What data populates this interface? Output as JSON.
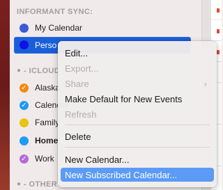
{
  "sidebar": {
    "sections": [
      {
        "header": "INFORMANT SYNC:"
      },
      {
        "header": "- ICLOUD"
      },
      {
        "header": "- OTHER"
      }
    ],
    "calendars": [
      {
        "label": "My Calendar",
        "color": "#3b5bd6",
        "checked": false
      },
      {
        "label": "Personal",
        "color": "#1010e8",
        "checked": false,
        "editing": true
      },
      {
        "label": "Alaska",
        "color": "#f28a12",
        "checked": true
      },
      {
        "label": "Calendar",
        "color": "#1d9bf0",
        "checked": true
      },
      {
        "label": "Family",
        "color": "#e6c410",
        "checked": false
      },
      {
        "label": "Home",
        "color": "#1d9bf0",
        "checked": false,
        "bold": true
      },
      {
        "label": "Work",
        "color": "#b46ad8",
        "checked": true
      }
    ]
  },
  "edit_field": {
    "value": "Perso"
  },
  "context_menu": {
    "items": [
      {
        "label": "Edit...",
        "enabled": true
      },
      {
        "label": "Export...",
        "enabled": false
      },
      {
        "label": "Share",
        "enabled": false,
        "submenu": true
      },
      {
        "label": "Make Default for New Events",
        "enabled": true
      },
      {
        "label": "Refresh",
        "enabled": false
      },
      {
        "label": "Delete",
        "enabled": true
      },
      {
        "label": "New Calendar...",
        "enabled": true
      },
      {
        "label": "New Subscribed Calendar...",
        "enabled": true,
        "selected": true
      }
    ],
    "chevron": "chevron-right-icon"
  }
}
